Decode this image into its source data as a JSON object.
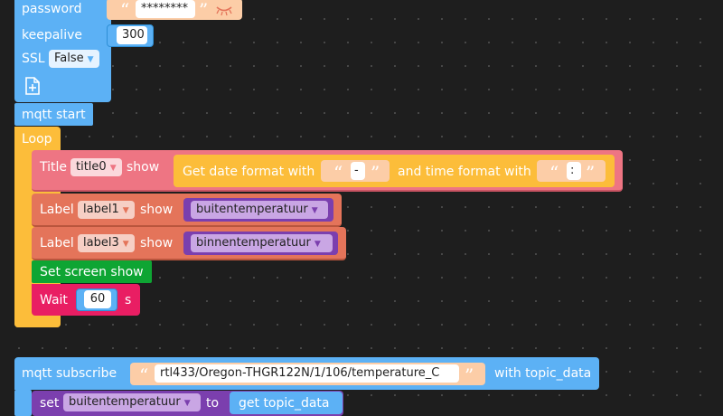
{
  "mqtt_config": {
    "password_label": "password",
    "password_value": "********",
    "keepalive_label": "keepalive",
    "keepalive_value": "300",
    "ssl_label": "SSL",
    "ssl_value": "False"
  },
  "mqtt_start": {
    "label": "mqtt start"
  },
  "loop": {
    "label": "Loop",
    "title_row": {
      "prefix": "Title",
      "target": "title0",
      "show": "show",
      "date_label": "Get date format with",
      "date_sep": "-",
      "time_label": "and time format with",
      "time_sep": ":"
    },
    "label1_row": {
      "prefix": "Label",
      "target": "label1",
      "show": "show",
      "variable": "buitentemperatuur"
    },
    "label3_row": {
      "prefix": "Label",
      "target": "label3",
      "show": "show",
      "variable": "binnentemperatuur"
    },
    "set_screen": {
      "label": "Set screen show"
    },
    "wait": {
      "label": "Wait",
      "value": "60",
      "unit": "s"
    }
  },
  "subscribe": {
    "label": "mqtt subscribe",
    "topic": "rtl433/Oregon-THGR122N/1/106/temperature_C",
    "with_label": "with topic_data",
    "set_label": "set",
    "set_variable": "buitentemperatuur",
    "to_label": "to",
    "get_label": "get topic_data"
  },
  "colors": {
    "mqtt": "#5cb1f5",
    "loop": "#fcbd3a",
    "title": "#ee7583",
    "label": "#e4745a",
    "variable": "#7b3fae",
    "screen": "#0ea533",
    "wait": "#e91e63",
    "text_block": "#fccda7"
  }
}
